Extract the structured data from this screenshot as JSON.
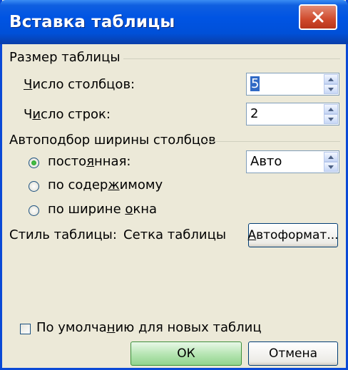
{
  "dialog": {
    "title": "Вставка таблицы",
    "close_glyph": "x"
  },
  "table_size": {
    "section_label": "Размер таблицы",
    "columns": {
      "label_pre": "",
      "label_u": "Ч",
      "label_post": "исло столбцов:",
      "value": "5"
    },
    "rows": {
      "label_pre": "Ч",
      "label_u": "и",
      "label_post": "сло строк:",
      "value": "2"
    }
  },
  "autofit": {
    "section_label": "Автоподбор ширины столбцов",
    "fixed": {
      "label_pre": "посто",
      "label_u": "я",
      "label_post": "нная:",
      "checked": true,
      "value": "Авто"
    },
    "by_content": {
      "label_pre": "по содер",
      "label_u": "ж",
      "label_post": "имому",
      "checked": false
    },
    "by_window": {
      "label_pre": "по ширине ",
      "label_u": "о",
      "label_post": "кна",
      "checked": false
    }
  },
  "style": {
    "label": "Стиль таблицы:",
    "value": "Сетка таблицы",
    "autoformat_pre": "",
    "autoformat_u": "А",
    "autoformat_post": "втоформат..."
  },
  "default_checkbox": {
    "label_pre": "По умолча",
    "label_u": "н",
    "label_post": "ию для новых таблиц",
    "checked": false
  },
  "buttons": {
    "ok": "ОК",
    "cancel": "Отмена"
  },
  "colors": {
    "titlebar": "#0054e3",
    "dialog_bg": "#ece9d8",
    "radio_dot": "#21a121",
    "close_button": "#cf4a2c"
  }
}
